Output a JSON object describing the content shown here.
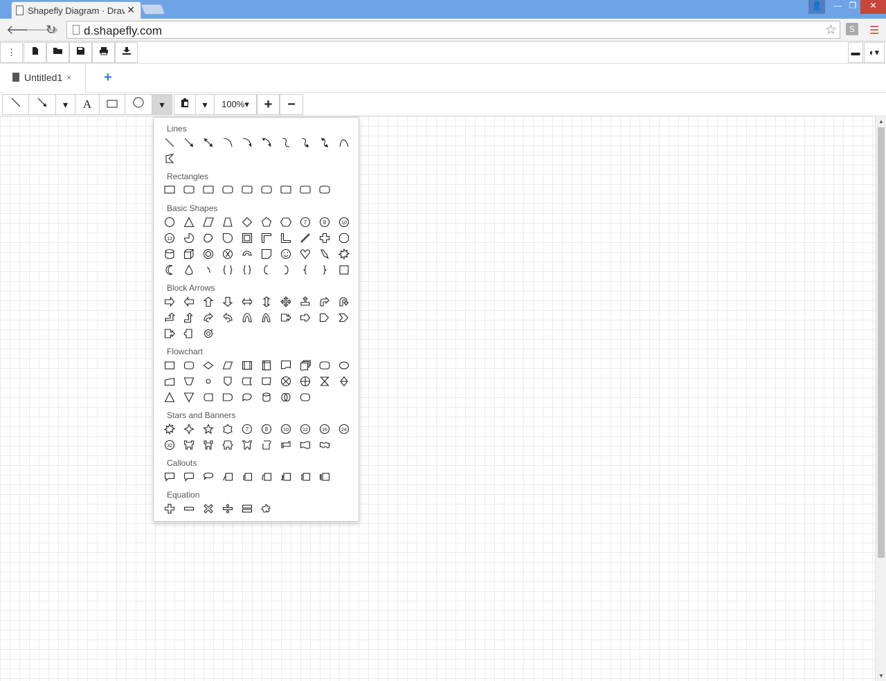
{
  "browser": {
    "tab_title": "Shapefly Diagram · Drav",
    "tab_close": "✕",
    "url": "d.shapefly.com",
    "ext_label": "S"
  },
  "app_toolbar": {
    "buttons": [
      "more-icon",
      "new-file-icon",
      "open-folder-icon",
      "save-icon",
      "print-icon",
      "export-icon"
    ]
  },
  "document_tabs": {
    "tabs": [
      {
        "label": "Untitled1",
        "close": "×"
      }
    ],
    "add_label": "+"
  },
  "draw_toolbar": {
    "text_tool_label": "A",
    "zoom_label": "100%▾",
    "zoom_in_label": "+",
    "zoom_out_label": "−"
  },
  "shapes_panel": {
    "sections": [
      {
        "title": "Lines",
        "count": 11
      },
      {
        "title": "Rectangles",
        "count": 9
      },
      {
        "title": "Basic Shapes",
        "count": 40
      },
      {
        "title": "Block Arrows",
        "count": 23
      },
      {
        "title": "Flowchart",
        "count": 28
      },
      {
        "title": "Stars and Banners",
        "count": 19
      },
      {
        "title": "Callouts",
        "count": 9
      },
      {
        "title": "Equation",
        "count": 6
      }
    ],
    "basic_shape_labels": [
      "7",
      "8",
      "10",
      "12"
    ],
    "star_labels": [
      "7",
      "8",
      "10",
      "12",
      "16",
      "24",
      "32"
    ]
  }
}
